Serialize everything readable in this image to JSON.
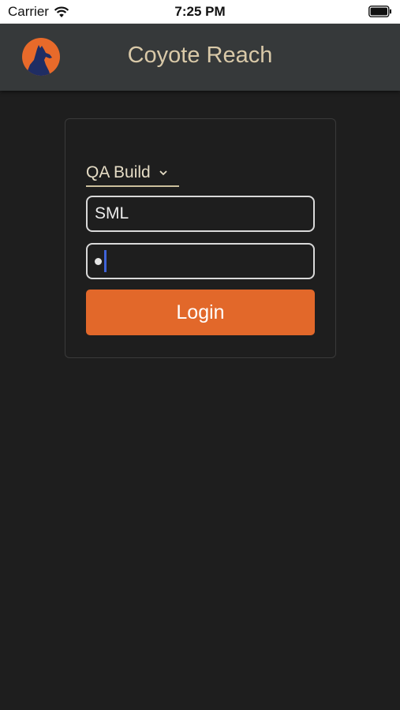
{
  "status_bar": {
    "carrier": "Carrier",
    "time": "7:25 PM",
    "icons": [
      "wifi-icon",
      "battery-icon"
    ]
  },
  "header": {
    "title": "Coyote Reach",
    "logo_icon": "coyote-howling-logo"
  },
  "login": {
    "environment": "QA Build",
    "username_value": "SML",
    "password_masked_chars": 1,
    "button_label": "Login"
  },
  "colors": {
    "accent": "#e2682a",
    "header_bg": "#36393a",
    "title_text": "#d9c9a8",
    "background": "#1e1e1e",
    "caret": "#3f63d8"
  }
}
